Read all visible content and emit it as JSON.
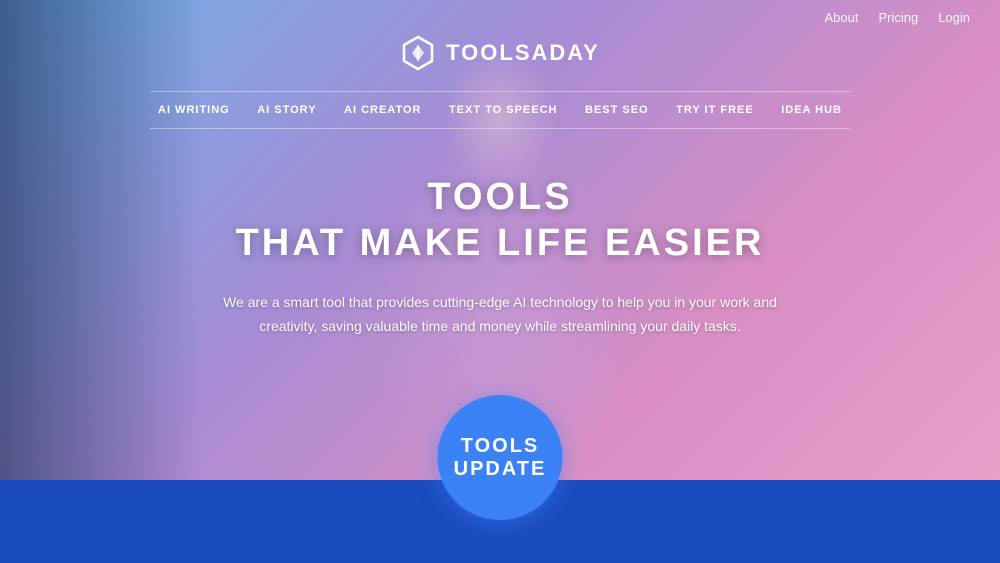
{
  "header": {
    "top_links": [
      {
        "label": "About",
        "id": "about"
      },
      {
        "label": "Pricing",
        "id": "pricing"
      },
      {
        "label": "Login",
        "id": "login"
      }
    ],
    "logo_text": "TOOLSADAY"
  },
  "nav": {
    "items": [
      {
        "label": "AI WRITING",
        "id": "ai-writing"
      },
      {
        "label": "AI STORY",
        "id": "ai-story"
      },
      {
        "label": "AI CREATOR",
        "id": "ai-creator"
      },
      {
        "label": "TEXT TO SPEECH",
        "id": "text-to-speech"
      },
      {
        "label": "BEST SEO",
        "id": "best-seo"
      },
      {
        "label": "TRY IT FREE",
        "id": "try-it-free"
      },
      {
        "label": "IDEA HUB",
        "id": "idea-hub"
      }
    ]
  },
  "hero": {
    "title_line1": "TOOLS",
    "title_line2": "THAT MAKE LIFE EASIER",
    "description": "We are a smart tool that provides cutting-edge AI technology\nto help you in your work and creativity, saving valuable time\nand money while streamlining your daily tasks."
  },
  "badge": {
    "line1": "TOOLS",
    "line2": "UPDATE"
  },
  "colors": {
    "accent_blue": "#1a4bbf",
    "badge_blue": "#3b82f6"
  }
}
